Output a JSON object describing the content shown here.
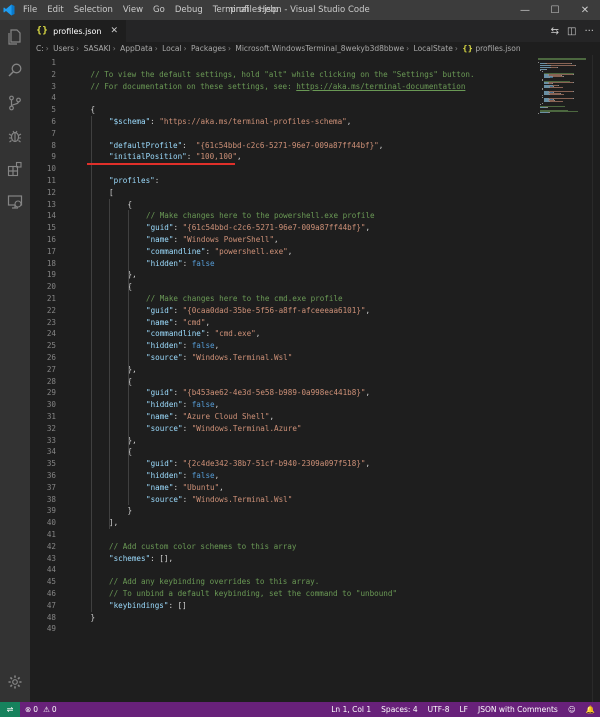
{
  "titlebar": {
    "menu": [
      "File",
      "Edit",
      "Selection",
      "View",
      "Go",
      "Debug",
      "Terminal",
      "Help"
    ],
    "title": "profiles.json - Visual Studio Code",
    "icons": [
      "minimize-icon",
      "maximize-icon",
      "close-icon"
    ]
  },
  "activitybar": {
    "items": [
      "explorer-icon",
      "search-icon",
      "source-control-icon",
      "debug-icon",
      "extensions-icon",
      "remote-explorer-icon"
    ],
    "bottom": "manage-gear-icon"
  },
  "tab": {
    "label": "profiles.json",
    "icon": "json-file-icon"
  },
  "tab_actions": [
    "compare-icon",
    "split-editor-icon",
    "more-actions-icon"
  ],
  "breadcrumb": {
    "segments": [
      "C:",
      "Users",
      "SASAKI",
      "AppData",
      "Local",
      "Packages",
      "Microsoft.WindowsTerminal_8wekyb3d8bbwe",
      "LocalState"
    ],
    "file": "profiles.json"
  },
  "editor": {
    "line_numbers": [
      "1",
      "2",
      "3",
      "4",
      "5",
      "6",
      "7",
      "8",
      "9",
      "10",
      "11",
      "12",
      "13",
      "14",
      "15",
      "16",
      "17",
      "18",
      "19",
      "20",
      "21",
      "22",
      "23",
      "24",
      "25",
      "26",
      "27",
      "28",
      "29",
      "30",
      "31",
      "32",
      "33",
      "34",
      "35",
      "36",
      "37",
      "38",
      "39",
      "40",
      "41",
      "42",
      "43",
      "44",
      "45",
      "46",
      "47",
      "48",
      "49"
    ],
    "lines": [
      [],
      [
        [
          "c",
          "// To view the default settings, hold \"alt\" while clicking on the \"Settings\" button."
        ]
      ],
      [
        [
          "c",
          "// For documentation on these settings, see: "
        ],
        [
          "l",
          "https://aka.ms/terminal-documentation"
        ]
      ],
      [],
      [
        [
          "p",
          "{"
        ]
      ],
      [
        [
          "k",
          "\"$schema\""
        ],
        [
          "p",
          ": "
        ],
        [
          "s",
          "\"https://aka.ms/terminal-profiles-schema\""
        ],
        [
          "p",
          ","
        ]
      ],
      [],
      [
        [
          "k",
          "\"defaultProfile\""
        ],
        [
          "p",
          ":  "
        ],
        [
          "s",
          "\"{61c54bbd-c2c6-5271-96e7-009a87ff44bf}\""
        ],
        [
          "p",
          ","
        ]
      ],
      [
        [
          "k",
          "\"initialPosition\""
        ],
        [
          "p",
          ": "
        ],
        [
          "s",
          "\"100,100\""
        ],
        [
          "p",
          ","
        ]
      ],
      [],
      [
        [
          "k",
          "\"profiles\""
        ],
        [
          "p",
          ":"
        ]
      ],
      [
        [
          "p",
          "["
        ]
      ],
      [
        [
          "p",
          "{"
        ]
      ],
      [
        [
          "c",
          "// Make changes here to the powershell.exe profile"
        ]
      ],
      [
        [
          "k",
          "\"guid\""
        ],
        [
          "p",
          ": "
        ],
        [
          "s",
          "\"{61c54bbd-c2c6-5271-96e7-009a87ff44bf}\""
        ],
        [
          "p",
          ","
        ]
      ],
      [
        [
          "k",
          "\"name\""
        ],
        [
          "p",
          ": "
        ],
        [
          "s",
          "\"Windows PowerShell\""
        ],
        [
          "p",
          ","
        ]
      ],
      [
        [
          "k",
          "\"commandline\""
        ],
        [
          "p",
          ": "
        ],
        [
          "s",
          "\"powershell.exe\""
        ],
        [
          "p",
          ","
        ]
      ],
      [
        [
          "k",
          "\"hidden\""
        ],
        [
          "p",
          ": "
        ],
        [
          "b",
          "false"
        ]
      ],
      [
        [
          "p",
          "},"
        ]
      ],
      [
        [
          "p",
          "{"
        ]
      ],
      [
        [
          "c",
          "// Make changes here to the cmd.exe profile"
        ]
      ],
      [
        [
          "k",
          "\"guid\""
        ],
        [
          "p",
          ": "
        ],
        [
          "s",
          "\"{0caa0dad-35be-5f56-a8ff-afceeeaa6101}\""
        ],
        [
          "p",
          ","
        ]
      ],
      [
        [
          "k",
          "\"name\""
        ],
        [
          "p",
          ": "
        ],
        [
          "s",
          "\"cmd\""
        ],
        [
          "p",
          ","
        ]
      ],
      [
        [
          "k",
          "\"commandline\""
        ],
        [
          "p",
          ": "
        ],
        [
          "s",
          "\"cmd.exe\""
        ],
        [
          "p",
          ","
        ]
      ],
      [
        [
          "k",
          "\"hidden\""
        ],
        [
          "p",
          ": "
        ],
        [
          "b",
          "false"
        ],
        [
          "p",
          ","
        ]
      ],
      [
        [
          "k",
          "\"source\""
        ],
        [
          "p",
          ": "
        ],
        [
          "s",
          "\"Windows.Terminal.Wsl\""
        ]
      ],
      [
        [
          "p",
          "},"
        ]
      ],
      [
        [
          "p",
          "{"
        ]
      ],
      [
        [
          "k",
          "\"guid\""
        ],
        [
          "p",
          ": "
        ],
        [
          "s",
          "\"{b453ae62-4e3d-5e58-b989-0a998ec441b8}\""
        ],
        [
          "p",
          ","
        ]
      ],
      [
        [
          "k",
          "\"hidden\""
        ],
        [
          "p",
          ": "
        ],
        [
          "b",
          "false"
        ],
        [
          "p",
          ","
        ]
      ],
      [
        [
          "k",
          "\"name\""
        ],
        [
          "p",
          ": "
        ],
        [
          "s",
          "\"Azure Cloud Shell\""
        ],
        [
          "p",
          ","
        ]
      ],
      [
        [
          "k",
          "\"source\""
        ],
        [
          "p",
          ": "
        ],
        [
          "s",
          "\"Windows.Terminal.Azure\""
        ]
      ],
      [
        [
          "p",
          "},"
        ]
      ],
      [
        [
          "p",
          "{"
        ]
      ],
      [
        [
          "k",
          "\"guid\""
        ],
        [
          "p",
          ": "
        ],
        [
          "s",
          "\"{2c4de342-38b7-51cf-b940-2309a097f518}\""
        ],
        [
          "p",
          ","
        ]
      ],
      [
        [
          "k",
          "\"hidden\""
        ],
        [
          "p",
          ": "
        ],
        [
          "b",
          "false"
        ],
        [
          "p",
          ","
        ]
      ],
      [
        [
          "k",
          "\"name\""
        ],
        [
          "p",
          ": "
        ],
        [
          "s",
          "\"Ubuntu\""
        ],
        [
          "p",
          ","
        ]
      ],
      [
        [
          "k",
          "\"source\""
        ],
        [
          "p",
          ": "
        ],
        [
          "s",
          "\"Windows.Terminal.Wsl\""
        ]
      ],
      [
        [
          "p",
          "}"
        ]
      ],
      [
        [
          "p",
          "],"
        ]
      ],
      [],
      [
        [
          "c",
          "// Add custom color schemes to this array"
        ]
      ],
      [
        [
          "k",
          "\"schemes\""
        ],
        [
          "p",
          ": [],"
        ]
      ],
      [],
      [
        [
          "c",
          "// Add any keybinding overrides to this array."
        ]
      ],
      [
        [
          "c",
          "// To unbind a default keybinding, set the command to \"unbound\""
        ]
      ],
      [
        [
          "k",
          "\"keybindings\""
        ],
        [
          "p",
          ": []"
        ]
      ],
      [
        [
          "p",
          "}"
        ]
      ],
      []
    ]
  },
  "statusbar": {
    "remote_icon": "remote-icon",
    "errors": "0",
    "warnings": "0",
    "position": "Ln 1, Col 1",
    "spaces": "Spaces: 4",
    "encoding": "UTF-8",
    "eol": "LF",
    "language": "JSON with Comments",
    "right_icons": [
      "feedback-icon",
      "bell-icon"
    ]
  },
  "colors": {
    "statusbar": "#68217a",
    "remote": "#16825d",
    "comment": "#6a9955",
    "key": "#9cdcfe",
    "string": "#ce9178",
    "keyword": "#569cd6"
  }
}
